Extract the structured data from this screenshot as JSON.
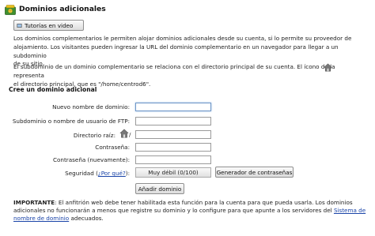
{
  "header": {
    "title": "Dominios adicionales",
    "icon": "domains-icon"
  },
  "video_button": {
    "label": "Tutorías en video",
    "icon": "video-icon"
  },
  "intro": {
    "line1": "Los dominios complementarios le permiten alojar dominios adicionales desde su cuenta, si lo permite su proveedor de",
    "line2": "alojamiento. Los visitantes pueden ingresar la URL del dominio complementario en un navegador para llegar a un subdominio",
    "line3": "de su sitio."
  },
  "relation": {
    "line1": "El subdominio de un dominio complementario se relaciona con el directorio principal de su cuenta. El ícono de la",
    "line1_tail": "representa",
    "line2": "el directorio principal, que es \"/home/centrod6\".",
    "icon": "house-icon"
  },
  "form": {
    "section_title": "Cree un dominio adicional",
    "new_domain_label": "Nuevo nombre de dominio:",
    "new_domain_value": "",
    "subdomain_label": "Subdominio o nombre de usuario de FTP:",
    "subdomain_value": "",
    "root_label": "Directorio raíz:",
    "root_slash": "/",
    "root_value": "",
    "password_label": "Contraseña:",
    "password_value": "",
    "password_again_label": "Contraseña (nuevamente):",
    "password_again_value": "",
    "security_label": "Seguridad",
    "security_paren_open": "(",
    "security_link": "¿Por qué?",
    "security_paren_close": "):",
    "strength_text": "Muy débil (0/100)",
    "strength_value": 0,
    "generator_button": "Generador de contraseñas",
    "add_button": "Añadir dominio"
  },
  "notice": {
    "bold": "IMPORTANTE",
    "text1": ": El anfitrión web debe tener habilitada esta función para la cuenta para que pueda usarla. Los dominios",
    "text2": "adicionales no funcionarán a menos que registre su dominio y lo configure para que apunte a los servidores del",
    "link_part1": "Sistema de",
    "link_part2": "nombre de dominio",
    "text3": "adecuados."
  },
  "colors": {
    "link": "#1a44a8",
    "focus": "#6f97c7"
  }
}
